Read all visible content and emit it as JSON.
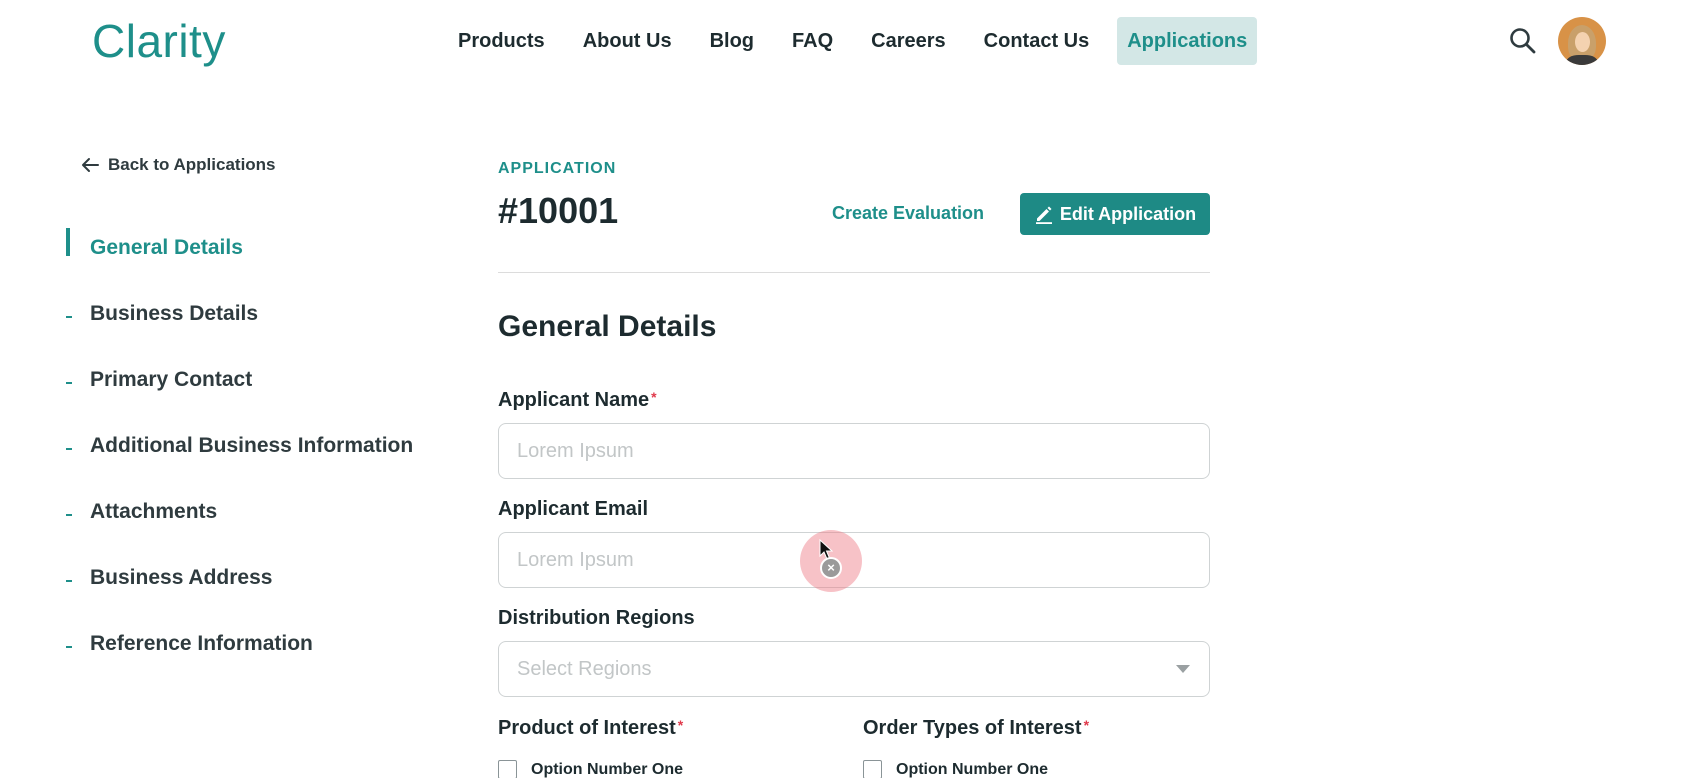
{
  "header": {
    "logo": "Clarity",
    "nav": [
      {
        "label": "Products",
        "active": false
      },
      {
        "label": "About Us",
        "active": false
      },
      {
        "label": "Blog",
        "active": false
      },
      {
        "label": "FAQ",
        "active": false
      },
      {
        "label": "Careers",
        "active": false
      },
      {
        "label": "Contact Us",
        "active": false
      },
      {
        "label": "Applications",
        "active": true
      }
    ],
    "search_icon": "search-icon",
    "avatar_icon": "user-avatar"
  },
  "sidebar": {
    "back_label": "Back to Applications",
    "items": [
      {
        "label": "General Details",
        "active": true
      },
      {
        "label": "Business Details",
        "active": false
      },
      {
        "label": "Primary Contact",
        "active": false
      },
      {
        "label": "Additional Business Information",
        "active": false
      },
      {
        "label": "Attachments",
        "active": false
      },
      {
        "label": "Business Address",
        "active": false
      },
      {
        "label": "Reference Information",
        "active": false
      }
    ]
  },
  "main": {
    "eyebrow": "APPLICATION",
    "application_id": "#10001",
    "create_evaluation_label": "Create Evaluation",
    "edit_button_label": "Edit Application",
    "section_title": "General Details",
    "fields": {
      "applicant_name": {
        "label": "Applicant Name",
        "required_mark": "*",
        "placeholder": "Lorem Ipsum",
        "value": ""
      },
      "applicant_email": {
        "label": "Applicant Email",
        "placeholder": "Lorem Ipsum",
        "value": ""
      },
      "distribution_regions": {
        "label": "Distribution Regions",
        "placeholder": "Select Regions"
      },
      "product_of_interest": {
        "label": "Product of Interest",
        "required_mark": "*",
        "options": [
          "Option Number One"
        ]
      },
      "order_types_of_interest": {
        "label": "Order Types of Interest",
        "required_mark": "*",
        "options": [
          "Option Number One"
        ]
      }
    }
  },
  "colors": {
    "brand": "#1e8f8a",
    "nav_active_bg": "#d3e7e6",
    "required": "#e0394b"
  }
}
